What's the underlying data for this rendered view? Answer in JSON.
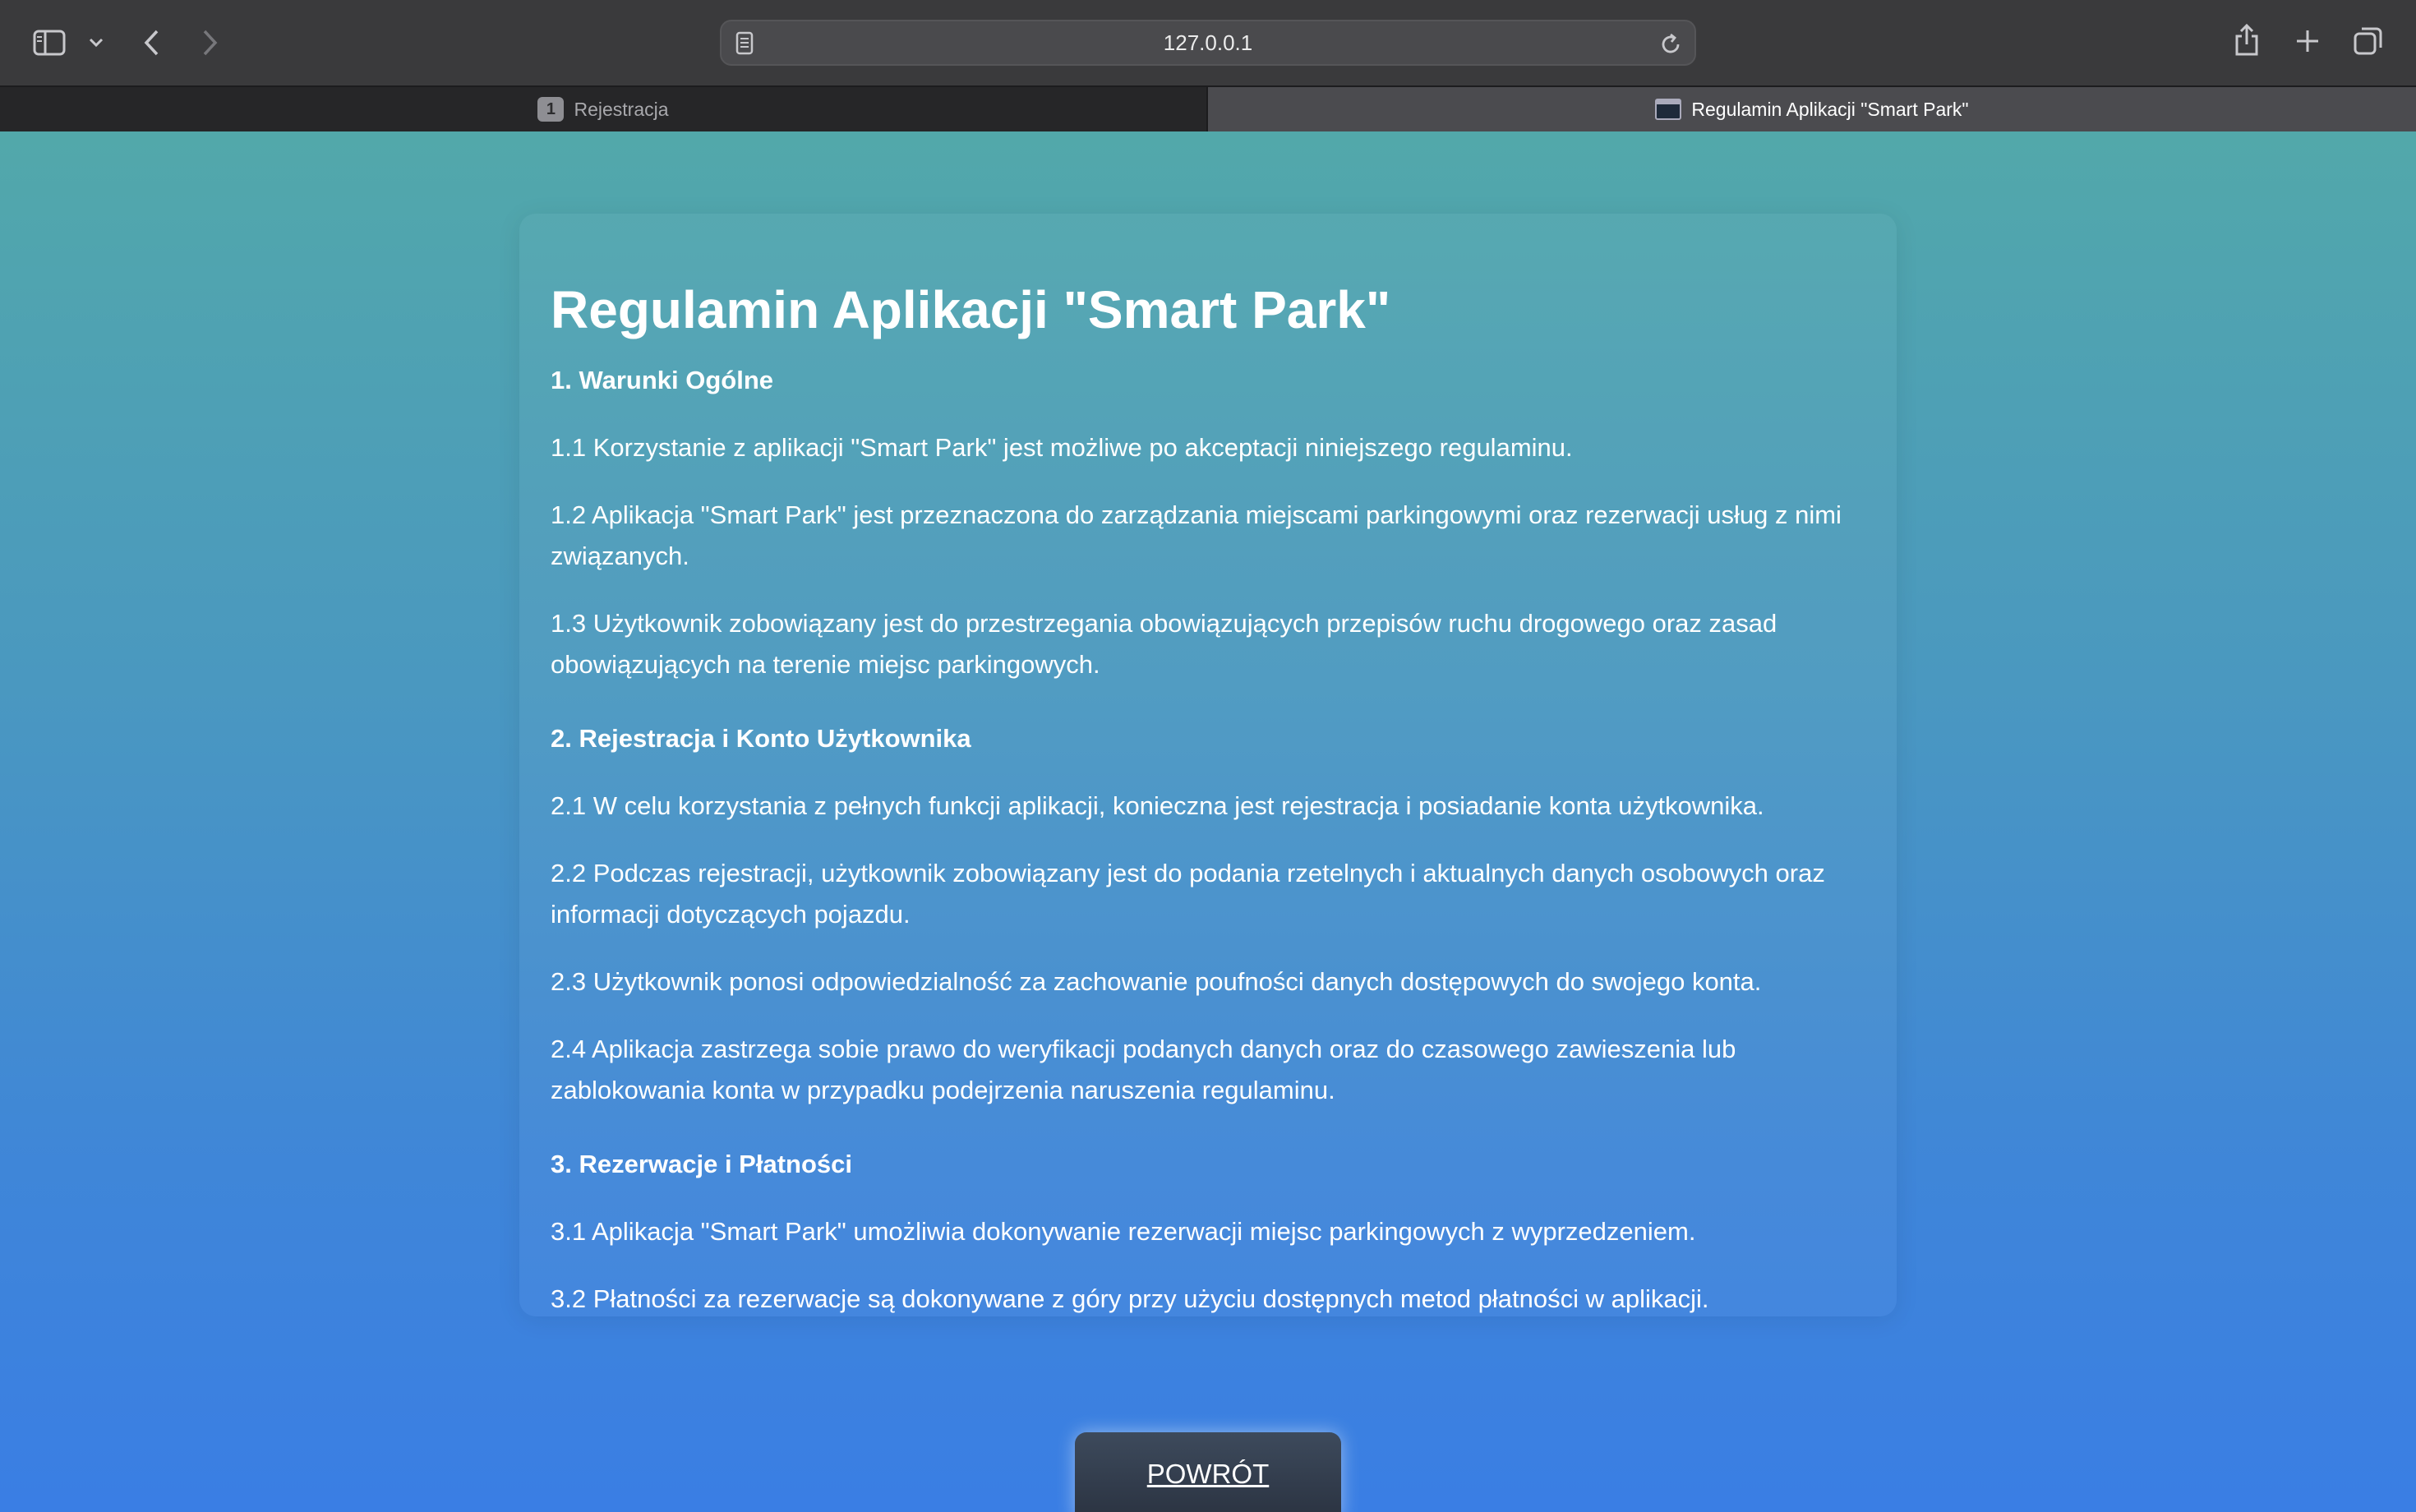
{
  "browser": {
    "url": "127.0.0.1",
    "tabs": [
      {
        "label": "Rejestracja",
        "badge": "1",
        "active": false
      },
      {
        "label": "Regulamin Aplikacji \"Smart Park\"",
        "active": true
      }
    ]
  },
  "terms": {
    "title": "Regulamin Aplikacji \"Smart Park\"",
    "sections": [
      {
        "heading": "1.  Warunki Ogólne",
        "items": [
          "1.1 Korzystanie z aplikacji \"Smart Park\" jest możliwe po akceptacji niniejszego regulaminu.",
          "1.2 Aplikacja \"Smart Park\" jest przeznaczona do zarządzania miejscami parkingowymi oraz rezerwacji usług z nimi związanych.",
          "1.3 Użytkownik zobowiązany jest do przestrzegania obowiązujących przepisów ruchu drogowego oraz zasad obowiązujących na terenie miejsc parkingowych."
        ]
      },
      {
        "heading": "2.  Rejestracja i Konto Użytkownika",
        "items": [
          "2.1 W celu korzystania z pełnych funkcji aplikacji, konieczna jest rejestracja i posiadanie konta użytkownika.",
          "2.2 Podczas rejestracji, użytkownik zobowiązany jest do podania rzetelnych i aktualnych danych osobowych oraz informacji dotyczących pojazdu.",
          "2.3 Użytkownik ponosi odpowiedzialność za zachowanie poufności danych dostępowych do swojego konta.",
          "2.4 Aplikacja zastrzega sobie prawo do weryfikacji podanych danych oraz do czasowego zawieszenia lub zablokowania konta w przypadku podejrzenia naruszenia regulaminu."
        ]
      },
      {
        "heading": "3.  Rezerwacje i Płatności",
        "items": [
          "3.1 Aplikacja \"Smart Park\" umożliwia dokonywanie rezerwacji miejsc parkingowych z wyprzedzeniem.",
          "3.2 Płatności za rezerwacje są dokonywane z góry przy użyciu dostępnych metod płatności w aplikacji."
        ]
      }
    ]
  },
  "back_button_label": "POWRÓT"
}
